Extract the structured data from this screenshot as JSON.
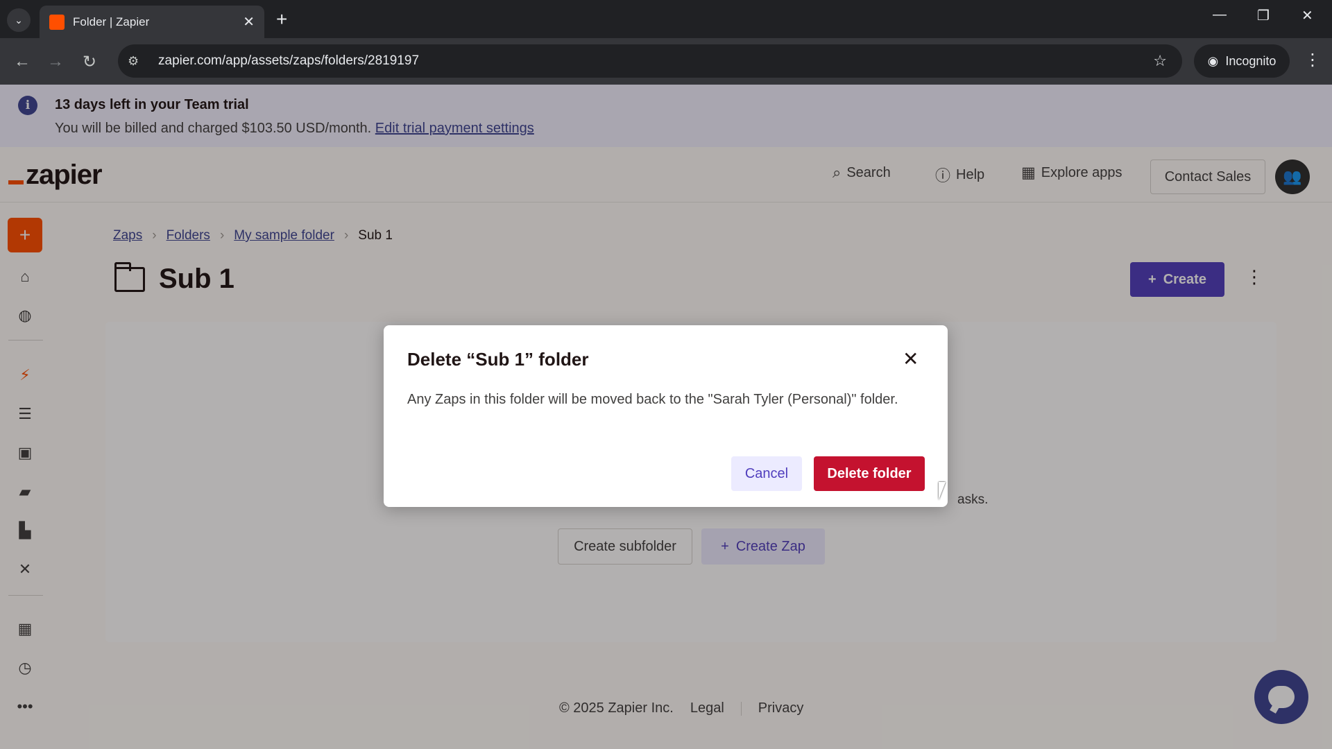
{
  "browser": {
    "tab_title": "Folder | Zapier",
    "tab_close": "✕",
    "new_tab": "+",
    "dropdown": "⌄",
    "url": "zapier.com/app/assets/zaps/folders/2819197",
    "incognito_label": "Incognito",
    "window_controls": {
      "minimize": "—",
      "restore": "❐",
      "close": "✕"
    }
  },
  "banner": {
    "title": "13 days left in your Team trial",
    "subtitle": "You will be billed and charged $103.50 USD/month.",
    "link": "Edit trial payment settings"
  },
  "header": {
    "logo": "zapier",
    "search": "Search",
    "help": "Help",
    "explore": "Explore apps",
    "contact_sales": "Contact Sales"
  },
  "breadcrumb": {
    "items": [
      "Zaps",
      "Folders",
      "My sample folder"
    ],
    "current": "Sub 1",
    "separator": "›"
  },
  "folder": {
    "title": "Sub 1",
    "create_button": "Create",
    "panel_text_fragment": "asks.",
    "create_subfolder": "Create subfolder",
    "create_zap": "Create Zap"
  },
  "footer": {
    "copyright": "© 2025 Zapier Inc.",
    "legal": "Legal",
    "privacy": "Privacy"
  },
  "modal": {
    "title": "Delete “Sub 1” folder",
    "body": "Any Zaps in this folder will be moved back to the \"Sarah Tyler (Personal)\" folder.",
    "cancel": "Cancel",
    "delete": "Delete folder",
    "close": "✕"
  },
  "colors": {
    "brand_orange": "#ff4f00",
    "primary_purple": "#503ebd",
    "danger_red": "#c4122f"
  }
}
